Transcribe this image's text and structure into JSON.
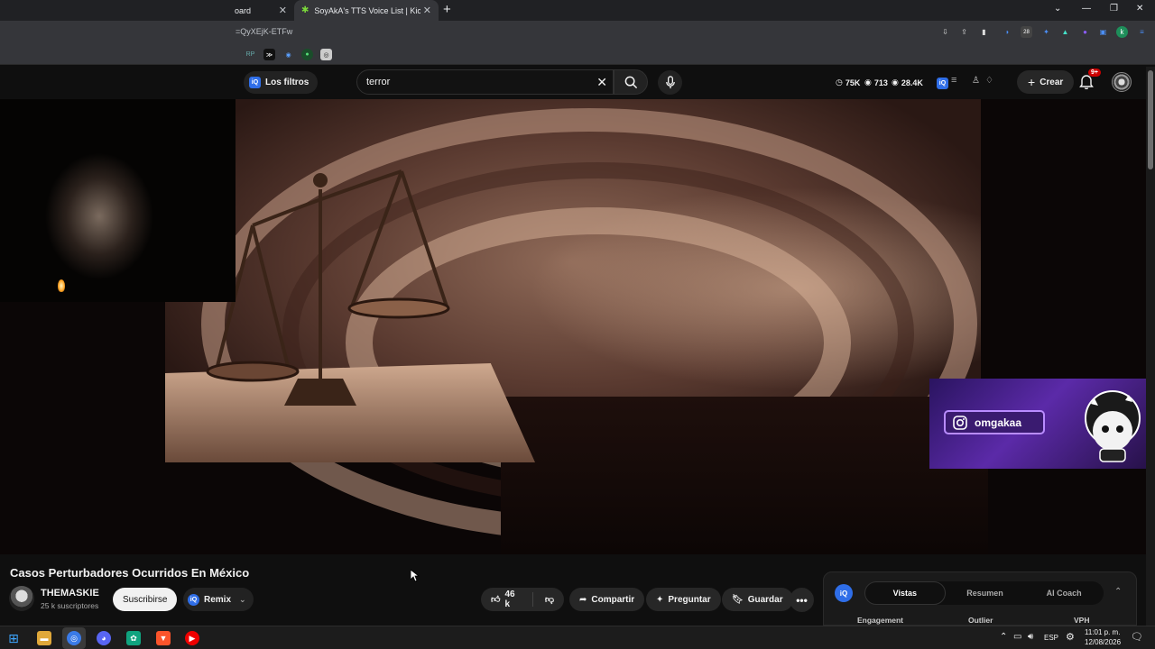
{
  "browser": {
    "tabs": [
      {
        "label": "oard",
        "active": false
      },
      {
        "label": "SoyAkA's TTS Voice List | KickBo",
        "active": true
      }
    ],
    "url": "=QyXEjK-ETFw",
    "extension_badge": "28"
  },
  "header": {
    "filters_label": "Los filtros",
    "search_value": "terror",
    "stats": {
      "subs": "75K",
      "views_a": "713",
      "views_b": "28.4K"
    },
    "create_label": "Crear",
    "notification_count": "9+"
  },
  "overlay": {
    "instagram_handle": "omgakaa"
  },
  "video": {
    "title": "Casos Perturbadores Ocurridos En México",
    "channel_name": "THEMASKIE",
    "channel_subs": "25 k suscriptores",
    "subscribe_label": "Suscribirse",
    "remix_label": "Remix",
    "likes": "46 k",
    "share_label": "Compartir",
    "ask_label": "Preguntar",
    "save_label": "Guardar"
  },
  "panel": {
    "tabs": [
      "Vistas",
      "Resumen",
      "AI Coach"
    ],
    "active_tab": 0,
    "columns": [
      "Engagement",
      "Outlier",
      "VPH"
    ]
  },
  "taskbar": {
    "language": "ESP",
    "time": "11:01 p. m.",
    "date": "12/08/2026"
  }
}
